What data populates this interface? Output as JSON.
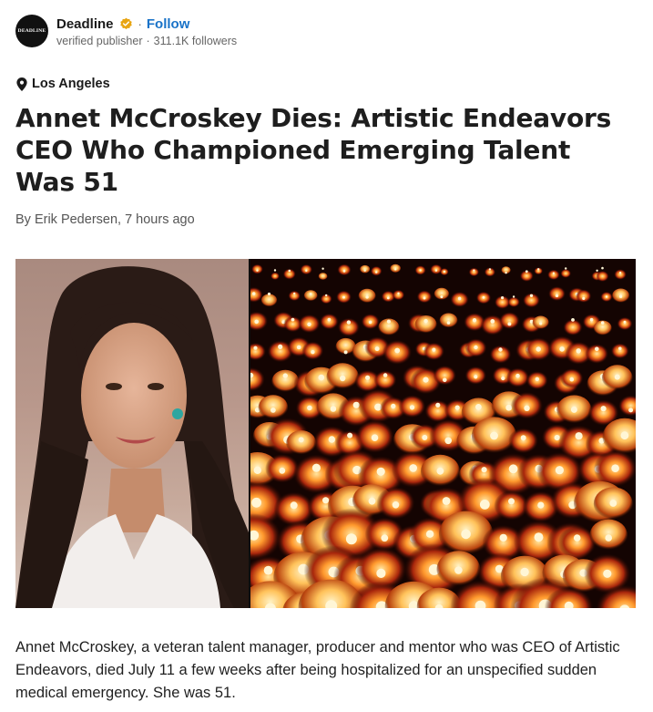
{
  "publisher": {
    "logo_text": "DEADLINE",
    "name": "Deadline",
    "separator": "·",
    "follow_label": "Follow",
    "status": "verified publisher",
    "followers": "311.1K followers",
    "verified_color": "#e8a512",
    "follow_color": "#1a73c8"
  },
  "article": {
    "location": "Los Angeles",
    "headline": "Annet McCroskey Dies: Artistic Endeavors CEO Who Championed Emerging Talent Was 51",
    "byline": "By Erik Pedersen, 7 hours ago",
    "body": "Annet McCroskey, a veteran talent manager, producer and mentor who was CEO of Artistic Endeavors, died July 11 a few weeks after being hospitalized for an unspeci­fied sudden medical emergency. She was 51."
  },
  "icons": {
    "verified": "verified-badge-icon",
    "location": "location-pin-icon"
  }
}
